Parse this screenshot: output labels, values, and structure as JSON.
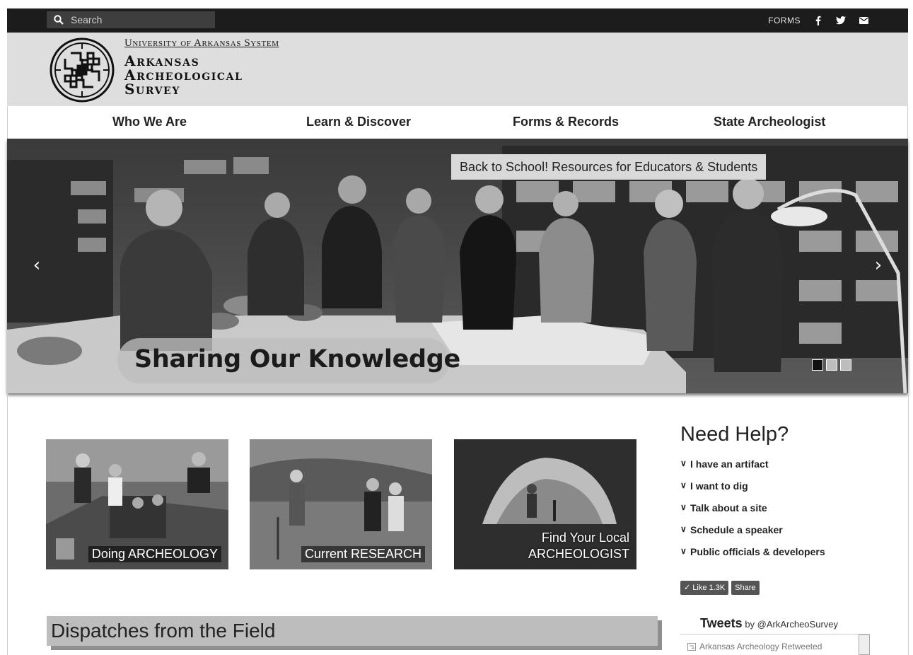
{
  "topbar": {
    "search_placeholder": "Search",
    "forms_link": "FORMS",
    "social": [
      "facebook-icon",
      "twitter-icon",
      "email-icon"
    ]
  },
  "header": {
    "system_name": "University of Arkansas System",
    "title_lines": [
      "Arkansas",
      "Archeological",
      "Survey"
    ]
  },
  "nav": {
    "items": [
      "Who We Are",
      "Learn & Discover",
      "Forms & Records",
      "State Archeologist"
    ]
  },
  "hero": {
    "banner": "Back to School! Resources for Educators & Students",
    "caption": "Sharing Our Knowledge",
    "slide_count": 3,
    "active_slide": 1
  },
  "tiles": [
    {
      "label": "Doing ARCHEOLOGY"
    },
    {
      "label": "Current RESEARCH"
    },
    {
      "label_lines": [
        "Find Your Local",
        "ARCHEOLOGIST"
      ]
    }
  ],
  "help": {
    "title": "Need Help?",
    "items": [
      "I have an artifact",
      "I want to dig",
      "Talk about a site",
      "Schedule a speaker",
      "Public officials & developers"
    ]
  },
  "social_buttons": {
    "like": "Like",
    "like_count": "1.3K",
    "share": "Share"
  },
  "tweets": {
    "title": "Tweets",
    "by": "by @ArkArcheoSurvey",
    "first_item": "Arkansas Archeology Retweeted"
  },
  "dispatches": {
    "title": "Dispatches from the Field"
  },
  "colors": {
    "topbar": "#1c1c1c",
    "header_band": "#dedede",
    "dispatch_bar": "#bdbdbd"
  }
}
